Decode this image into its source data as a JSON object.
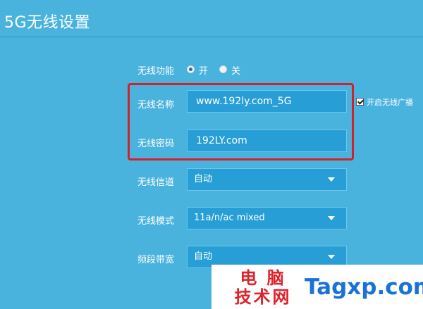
{
  "page": {
    "title": "5G无线设置"
  },
  "wireless_function": {
    "label": "无线功能",
    "options": [
      {
        "label": "开",
        "selected": true
      },
      {
        "label": "关",
        "selected": false
      }
    ]
  },
  "ssid": {
    "label": "无线名称",
    "value": "www.192ly.com_5G"
  },
  "broadcast": {
    "label": "开启无线广播",
    "checked": true
  },
  "password": {
    "label": "无线密码",
    "value": "192LY.com"
  },
  "channel": {
    "label": "无线信道",
    "value": "自动"
  },
  "mode": {
    "label": "无线模式",
    "value": "11a/n/ac mixed"
  },
  "bandwidth": {
    "label": "频段带宽",
    "value": "自动"
  },
  "watermark": {
    "cn_line1": "电 脑",
    "cn_line2": "技术网",
    "domain": "Tagxp.com"
  },
  "colors": {
    "background": "#4ab3dd",
    "field": "#279fd6",
    "highlight": "#d3212b",
    "watermark_red": "#e0202a",
    "watermark_blue": "#1a72d8"
  }
}
